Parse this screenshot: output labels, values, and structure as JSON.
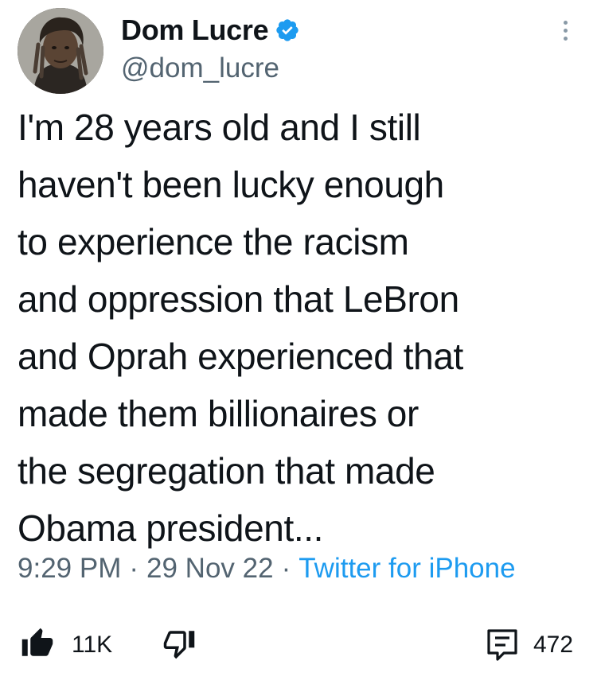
{
  "tweet": {
    "display_name": "Dom Lucre",
    "handle": "@dom_lucre",
    "verified": true,
    "text": "I'm 28 years old and I still\nhaven't been lucky enough\nto experience the racism\nand oppression that LeBron\nand Oprah experienced that\nmade them billionaires or\nthe segregation that made\nObama president...",
    "time": "9:29 PM",
    "separator": "·",
    "date": "29 Nov 22",
    "source": "Twitter for iPhone"
  },
  "reactions": {
    "likes": "11K",
    "comments": "472"
  },
  "icons": {
    "verified": "verified-badge-icon",
    "more": "more-vertical-icon",
    "like": "thumbs-up-icon",
    "dislike": "thumbs-down-icon",
    "comment": "comment-icon"
  },
  "colors": {
    "text": "#0f1419",
    "secondary": "#536471",
    "link": "#1d9bf0",
    "verified": "#1d9bf0"
  }
}
